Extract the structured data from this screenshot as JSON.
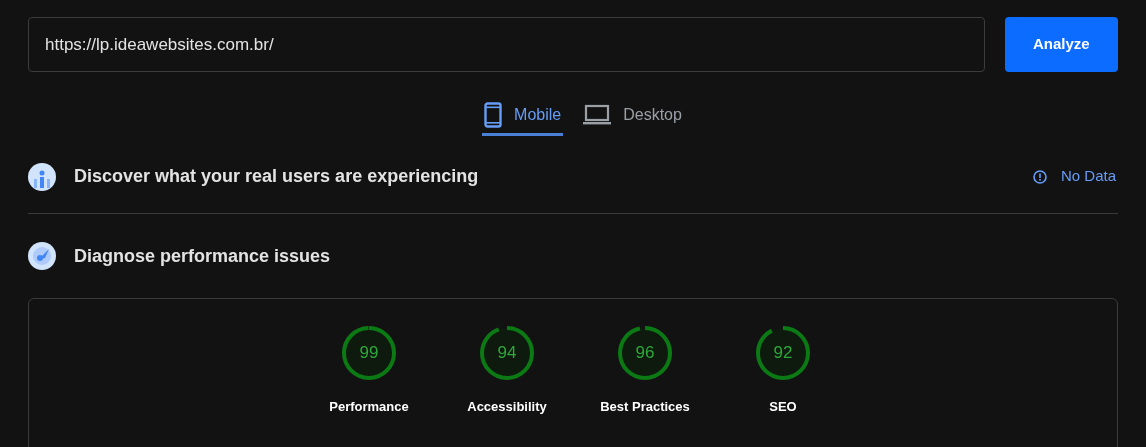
{
  "url_field": {
    "value": "https://lp.ideawebsites.com.br/"
  },
  "analyze_button": {
    "label": "Analyze"
  },
  "tabs": [
    {
      "label": "Mobile",
      "kind": "mobile",
      "selected": true
    },
    {
      "label": "Desktop",
      "kind": "desktop",
      "selected": false
    }
  ],
  "field_data": {
    "title": "Discover what your real users are experiencing",
    "status": "No Data"
  },
  "lab_data": {
    "title": "Diagnose performance issues"
  },
  "scores": [
    {
      "score": "99",
      "level": 0.99,
      "label": "Performance"
    },
    {
      "score": "94",
      "level": 0.94,
      "label": "Accessibility"
    },
    {
      "score": "96",
      "level": 0.96,
      "label": "Best Practices"
    },
    {
      "score": "92",
      "level": 0.92,
      "label": "SEO"
    }
  ]
}
